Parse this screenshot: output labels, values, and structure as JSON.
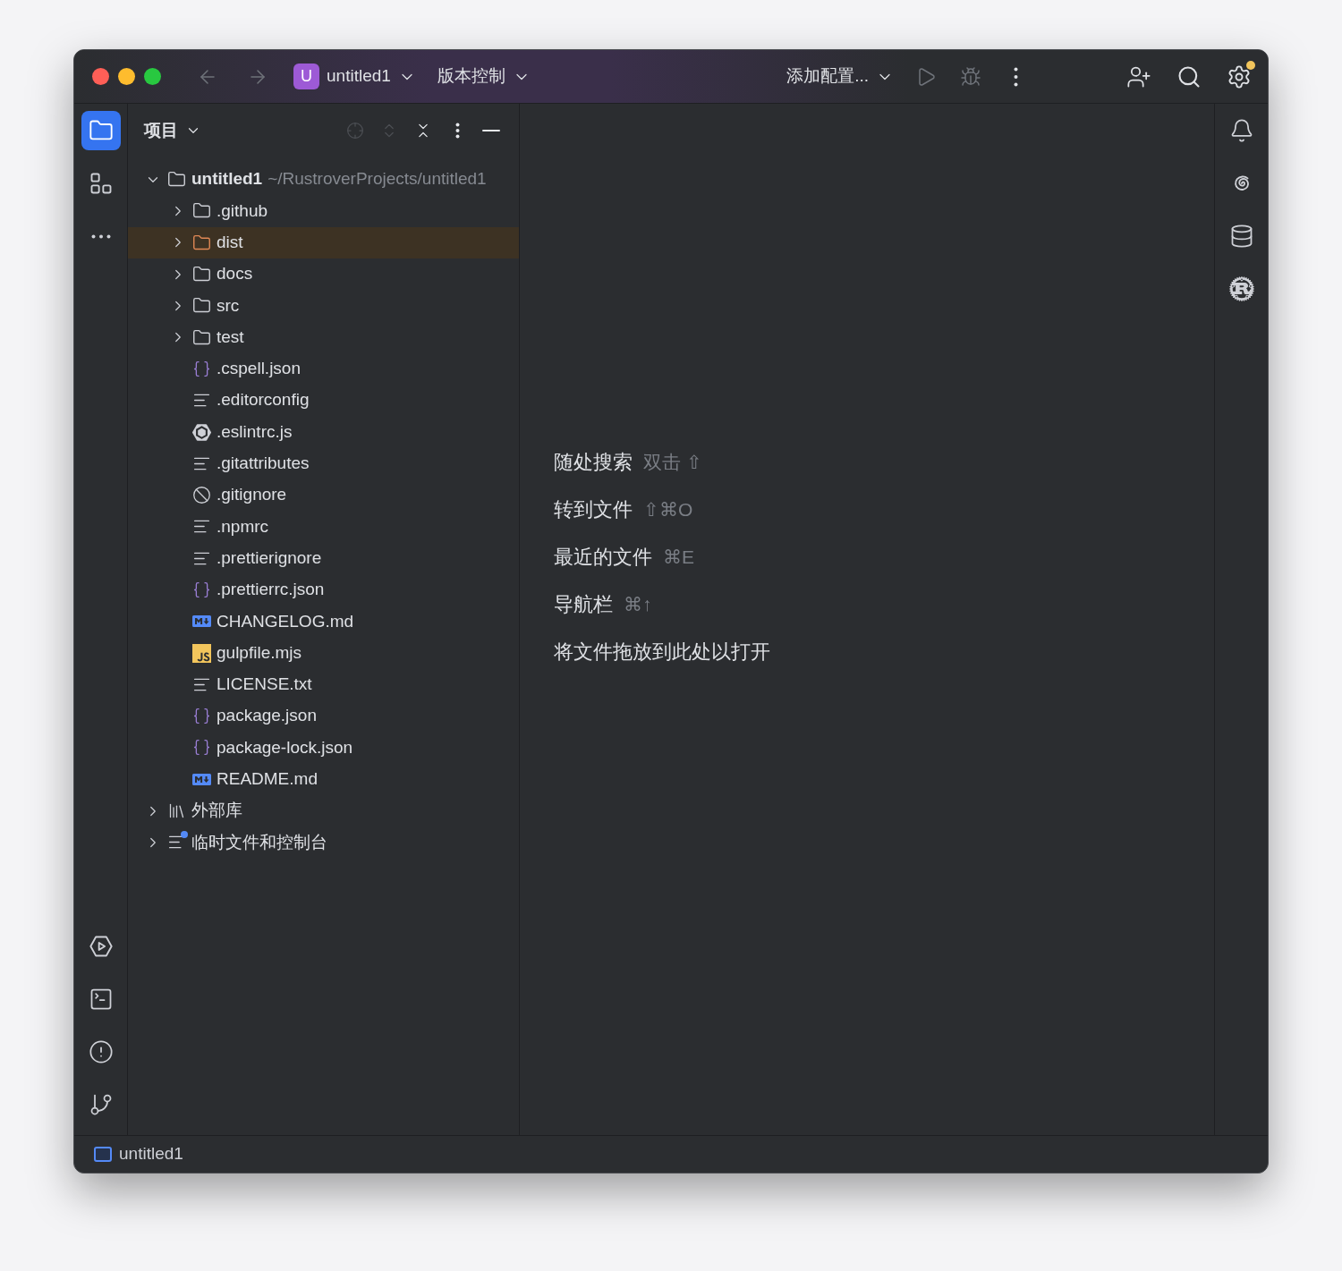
{
  "title_bar": {
    "back": {
      "disabled": true
    },
    "forward": {
      "disabled": true
    },
    "project": {
      "badge": "U",
      "name": "untitled1"
    },
    "vcs": "版本控制",
    "run_config": "添加配置...",
    "actions": [
      {
        "kind": "run",
        "disabled": true
      },
      {
        "kind": "debug",
        "disabled": true
      },
      {
        "kind": "more",
        "disabled": false
      }
    ],
    "right_actions": [
      {
        "kind": "add-user",
        "badge": false
      },
      {
        "kind": "search",
        "badge": false
      },
      {
        "kind": "settings",
        "badge": true
      }
    ]
  },
  "left_toolbar": {
    "top": [
      {
        "kind": "project",
        "selected": true
      },
      {
        "kind": "structure",
        "selected": false
      },
      {
        "kind": "more",
        "selected": false
      }
    ],
    "bottom": [
      {
        "kind": "run",
        "selected": false
      },
      {
        "kind": "terminal",
        "selected": false
      },
      {
        "kind": "problems",
        "selected": false
      },
      {
        "kind": "git",
        "selected": false
      }
    ]
  },
  "project_panel": {
    "title": "项目",
    "tools": [
      {
        "kind": "locate",
        "disabled": true
      },
      {
        "kind": "expand",
        "disabled": true
      },
      {
        "kind": "collapse",
        "disabled": false
      },
      {
        "kind": "more",
        "disabled": false
      },
      {
        "kind": "hide",
        "disabled": false
      }
    ],
    "tree": [
      {
        "name": "untitled1",
        "hint": "~/RustroverProjects/untitled1",
        "kind": "folder",
        "expanded": true,
        "selected": false,
        "children": [
          {
            "name": ".github",
            "kind": "folder",
            "expanded": false,
            "selected": false
          },
          {
            "name": "dist",
            "kind": "excluded-folder",
            "expanded": false,
            "selected": true
          },
          {
            "name": "docs",
            "kind": "folder",
            "expanded": false,
            "selected": false
          },
          {
            "name": "src",
            "kind": "folder",
            "expanded": false,
            "selected": false
          },
          {
            "name": "test",
            "kind": "folder",
            "expanded": false,
            "selected": false
          },
          {
            "name": ".cspell.json",
            "kind": "json",
            "selected": false
          },
          {
            "name": ".editorconfig",
            "kind": "text",
            "selected": false
          },
          {
            "name": ".eslintrc.js",
            "kind": "eslint",
            "selected": false
          },
          {
            "name": ".gitattributes",
            "kind": "text",
            "selected": false
          },
          {
            "name": ".gitignore",
            "kind": "ignore",
            "selected": false
          },
          {
            "name": ".npmrc",
            "kind": "text",
            "selected": false
          },
          {
            "name": ".prettierignore",
            "kind": "text",
            "selected": false
          },
          {
            "name": ".prettierrc.json",
            "kind": "json",
            "selected": false
          },
          {
            "name": "CHANGELOG.md",
            "kind": "markdown",
            "selected": false
          },
          {
            "name": "gulpfile.mjs",
            "kind": "js",
            "selected": false
          },
          {
            "name": "LICENSE.txt",
            "kind": "text",
            "selected": false
          },
          {
            "name": "package.json",
            "kind": "json",
            "selected": false
          },
          {
            "name": "package-lock.json",
            "kind": "json",
            "selected": false
          },
          {
            "name": "README.md",
            "kind": "markdown",
            "selected": false
          }
        ]
      },
      {
        "name": "外部库",
        "kind": "library",
        "expanded": false,
        "selected": false
      },
      {
        "name": "临时文件和控制台",
        "kind": "scratch",
        "expanded": false,
        "selected": false
      }
    ]
  },
  "editor_hints": [
    {
      "action": "随处搜索",
      "shortcut": "双击 ⇧"
    },
    {
      "action": "转到文件",
      "shortcut": "⇧⌘O"
    },
    {
      "action": "最近的文件",
      "shortcut": "⌘E"
    },
    {
      "action": "导航栏",
      "shortcut": "⌘↑"
    },
    {
      "action": "将文件拖放到此处以打开"
    }
  ],
  "right_toolbar": [
    {
      "kind": "notifications",
      "selected": false
    },
    {
      "kind": "ai",
      "selected": false
    },
    {
      "kind": "database",
      "selected": false
    },
    {
      "kind": "rust",
      "selected": false
    }
  ],
  "status_bar": {
    "project": "untitled1"
  }
}
